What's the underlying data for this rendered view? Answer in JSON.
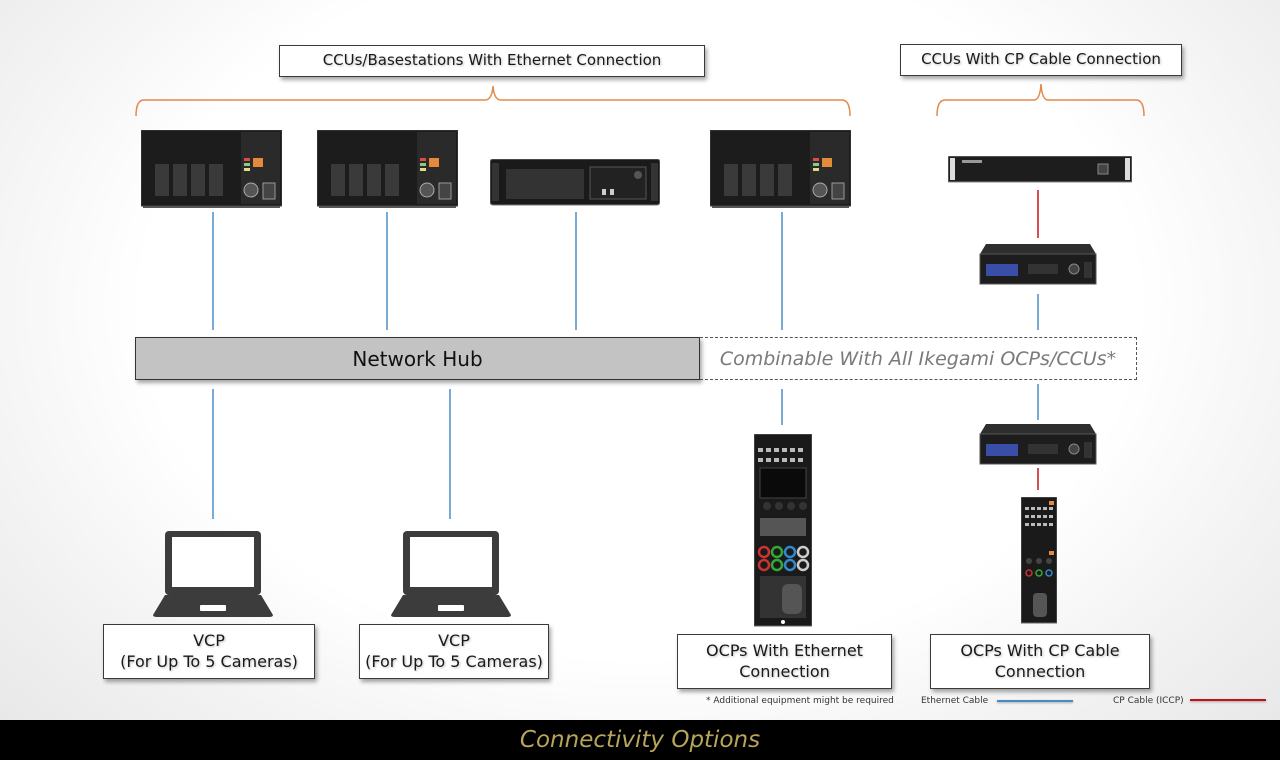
{
  "groups": {
    "ethernet_ccus": {
      "title": "CCUs/Basestations With Ethernet Connection"
    },
    "cp_ccus": {
      "title": "CCUs With CP Cable Connection"
    }
  },
  "hub": {
    "label": "Network Hub",
    "combinable_note": "Combinable With All Ikegami OCPs/CCUs*"
  },
  "endpoints": [
    {
      "title": "VCP",
      "subtitle": "(For Up To 5 Cameras)"
    },
    {
      "title": "VCP",
      "subtitle": "(For Up To 5 Cameras)"
    },
    {
      "title": "OCPs With Ethernet",
      "subtitle": "Connection"
    },
    {
      "title": "OCPs With CP Cable",
      "subtitle": "Connection"
    }
  ],
  "footnote": "* Additional equipment might be required",
  "legend": {
    "ethernet": {
      "label": "Ethernet Cable",
      "color": "#4a8ac4"
    },
    "cp": {
      "label": "CP Cable (ICCP)",
      "color": "#c1121c"
    }
  },
  "colors": {
    "bracket": "#e08a4a",
    "hub_fill": "#c3c3c3",
    "footer_text": "#b8a55a"
  },
  "footer": {
    "title": "Connectivity Options"
  }
}
